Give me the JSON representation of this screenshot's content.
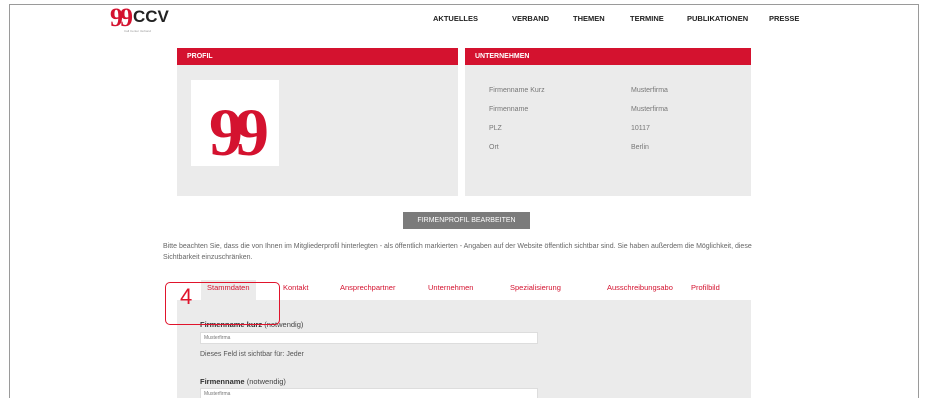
{
  "logo": {
    "quote": "99",
    "text": "CCV",
    "tagline": "Call Center Verband"
  },
  "nav": {
    "items": [
      "AKTUELLES",
      "VERBAND",
      "THEMEN",
      "TERMINE",
      "PUBLIKATIONEN",
      "PRESSE"
    ]
  },
  "profil": {
    "title": "PROFIL",
    "image_glyph": "99"
  },
  "unternehmen": {
    "title": "UNTERNEHMEN",
    "rows": [
      {
        "label": "Firmenname Kurz",
        "value": "Musterfirma"
      },
      {
        "label": "Firmenname",
        "value": "Musterfirma"
      },
      {
        "label": "PLZ",
        "value": "10117"
      },
      {
        "label": "Ort",
        "value": "Berlin"
      }
    ]
  },
  "edit_button": "FIRMENPROFIL BEARBEITEN",
  "notice": "Bitte beachten Sie, dass die von Ihnen im Mitgliederprofil hinterlegten - als öffentlich markierten - Angaben auf der Website öffentlich sichtbar sind. Sie haben außerdem die Möglichkeit, diese Sichtbarkeit einzuschränken.",
  "tabs": [
    "Stammdaten",
    "Kontakt",
    "Ansprechpartner",
    "Unternehmen",
    "Spezialisierung",
    "Ausschreibungsabo",
    "Profilbild"
  ],
  "active_tab": "Stammdaten",
  "form": {
    "fields": [
      {
        "label": "Firmenname kurz",
        "required": "(notwendig)",
        "value": "Musterfirma",
        "hint": "Dieses Feld ist sichtbar für: Jeder"
      },
      {
        "label": "Firmenname",
        "required": "(notwendig)",
        "value": "Musterfirma"
      }
    ]
  },
  "callout": {
    "number": "4"
  },
  "colors": {
    "accent": "#d4122f",
    "panel": "#ebebeb",
    "button": "#7b7b7b",
    "callout": "#e0142c"
  }
}
